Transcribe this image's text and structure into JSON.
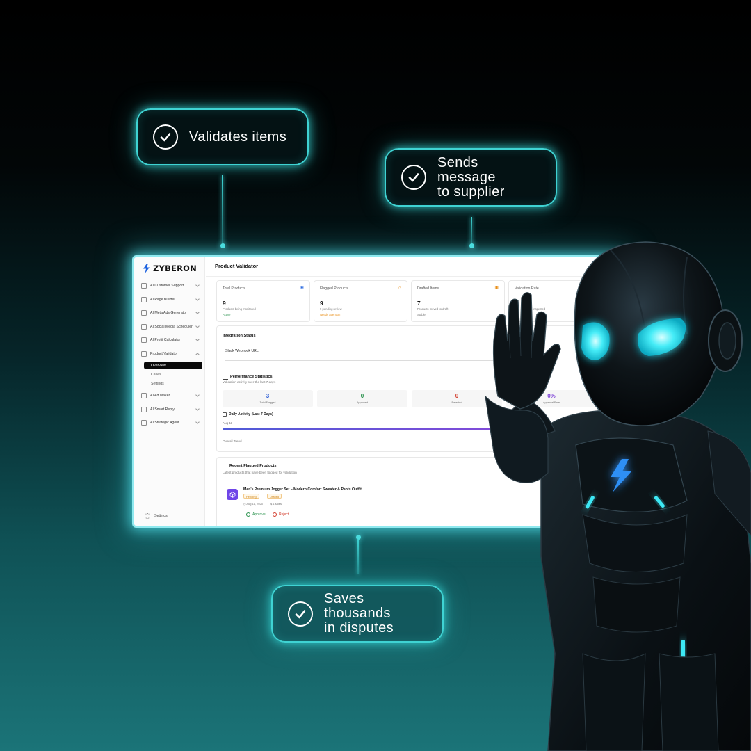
{
  "callouts": {
    "validates": {
      "line1": "Validates items"
    },
    "sends": {
      "line1": "Sends message",
      "line2": "to supplier"
    },
    "saves": {
      "line1": "Saves thousands",
      "line2": "in disputes"
    }
  },
  "app": {
    "brand": "ZYBERON",
    "page_title": "Product Validator",
    "sidebar": {
      "items": [
        {
          "label": "AI Customer Support",
          "icon": "headset-icon"
        },
        {
          "label": "AI Page Builder",
          "icon": "page-icon"
        },
        {
          "label": "AI Meta Ads Generator",
          "icon": "ads-icon"
        },
        {
          "label": "AI Social Media Scheduler",
          "icon": "calendar-icon"
        },
        {
          "label": "AI Profit Calculator",
          "icon": "calculator-icon"
        },
        {
          "label": "Product Validator",
          "icon": "cart-icon",
          "expanded": true
        },
        {
          "label": "AI Ad Maker",
          "icon": "ad-icon"
        },
        {
          "label": "AI Smart Reply",
          "icon": "chat-icon"
        },
        {
          "label": "AI Strategic Agent",
          "icon": "agent-icon"
        }
      ],
      "sub_items": [
        {
          "label": "Overview",
          "active": true
        },
        {
          "label": "Cases",
          "active": false
        },
        {
          "label": "Settings",
          "active": false
        }
      ],
      "footer_settings": "Settings"
    },
    "stats": [
      {
        "title": "Total Products",
        "value": "9",
        "desc": "Products being monitored",
        "foot": "Active",
        "icon": "eye-icon",
        "color": "#2f6de0"
      },
      {
        "title": "Flagged Products",
        "value": "9",
        "desc": "9 pending review",
        "foot": "Needs attention",
        "icon": "warning-icon",
        "color": "#e9901a"
      },
      {
        "title": "Drafted Items",
        "value": "7",
        "desc": "Products moved to draft",
        "foot": "Stable",
        "icon": "draft-icon",
        "color": "#e9901a"
      },
      {
        "title": "Validation Rate",
        "value": "",
        "desc": "Inspected",
        "foot": "",
        "icon": "",
        "color": "#2f6de0"
      }
    ],
    "integration": {
      "title": "Integration Status",
      "webhook_label": "Slack Webhook URL",
      "perf_title": "Performance Statistics",
      "perf_sub": "Validation activity over the last 7 days",
      "metrics": [
        {
          "value": "3",
          "label": "Total Flagged",
          "color": "#2f5fd6"
        },
        {
          "value": "0",
          "label": "Approved",
          "color": "#26904a"
        },
        {
          "value": "0",
          "label": "Rejected",
          "color": "#d23a2a"
        },
        {
          "value": "0%",
          "label": "Approval Rate",
          "color": "#7b3fd6"
        }
      ],
      "daily_title": "Daily Activity (Last 7 Days)",
      "daily_date": "Aug 11",
      "trend_label": "Overall Trend"
    },
    "recent": {
      "title": "Recent Flagged Products",
      "sub": "Latest products that have been flagged for validation",
      "item": {
        "name": "Men's Premium Jogger Set – Modern Comfort Sweater & Pants Outfit",
        "badge_pending": "Pending",
        "badge_drafted": "Drafted",
        "date": "Aug 11, 2025",
        "sales": "1 sales",
        "approve": "Approve",
        "reject": "Reject"
      }
    }
  },
  "colors": {
    "glow": "#3fd3d3",
    "robot_eye": "#3de8f5",
    "brand_blue": "#1e63e0"
  }
}
